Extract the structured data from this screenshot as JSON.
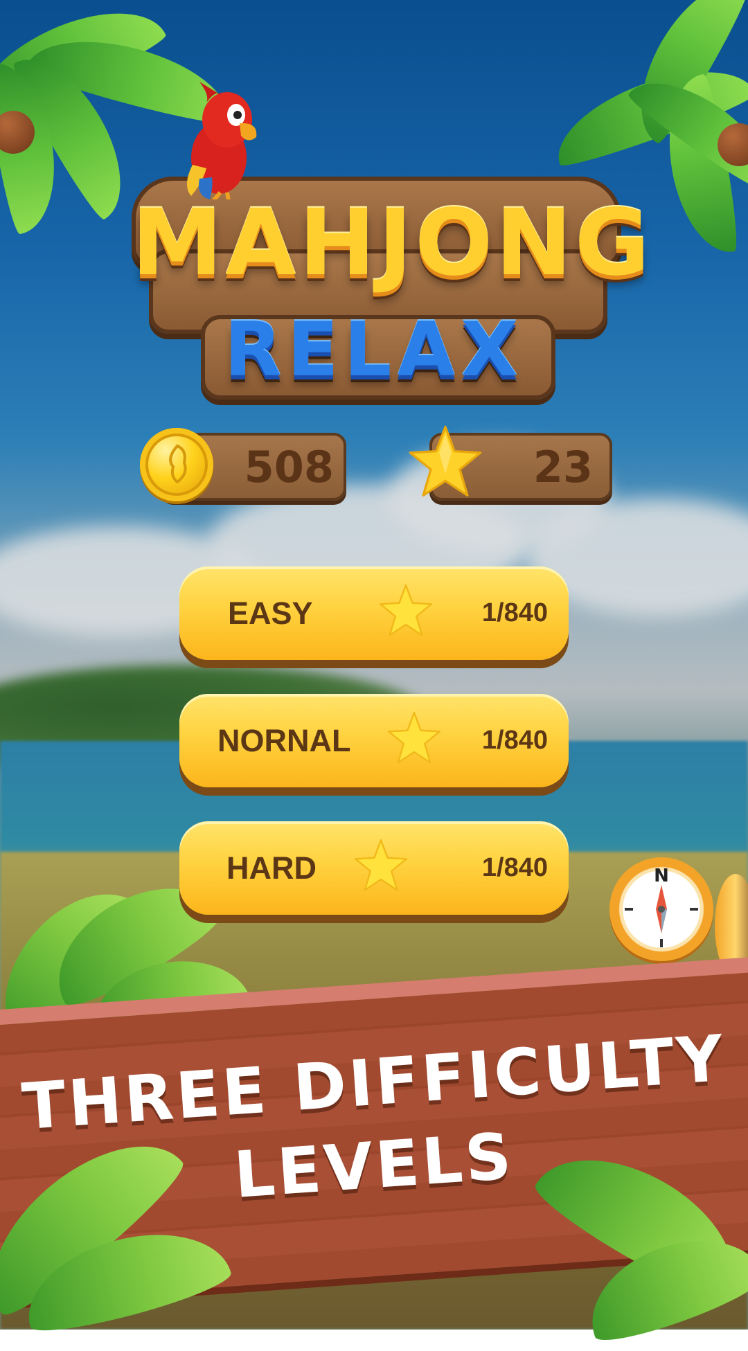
{
  "logo": {
    "title": "MAHJONG",
    "subtitle": "RELAX"
  },
  "counters": {
    "coins": "508",
    "stars": "23"
  },
  "levels": [
    {
      "name": "EASY",
      "progress": "1/840"
    },
    {
      "name": "NORNAL",
      "progress": "1/840"
    },
    {
      "name": "HARD",
      "progress": "1/840"
    }
  ],
  "banner": {
    "line1": "THREE DIFFICULTY",
    "line2": "LEVELS"
  },
  "compass": {
    "north_label": "N"
  },
  "colors": {
    "button": "#ffd23f",
    "button_text": "#5c3716",
    "banner": "#a14a30",
    "title": "#ffcf2f",
    "subtitle": "#2b7fe8"
  }
}
